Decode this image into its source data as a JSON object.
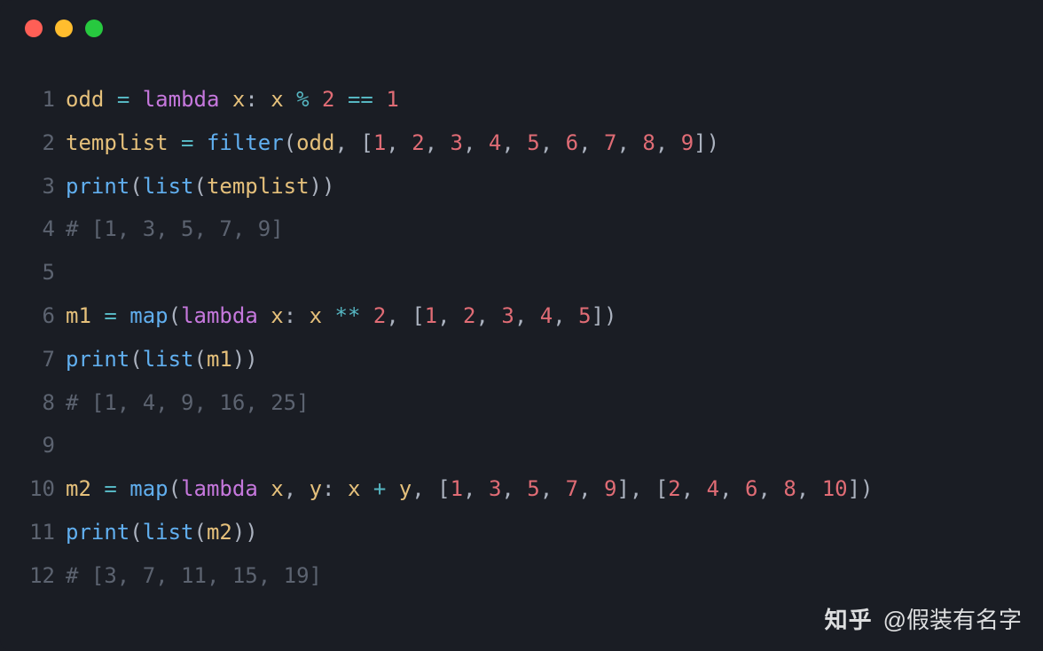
{
  "window": {
    "traffic_lights": [
      "close",
      "minimize",
      "maximize"
    ]
  },
  "watermark": {
    "logo": "知乎",
    "author": "@假装有名字"
  },
  "code": {
    "lines": [
      {
        "num": "1",
        "tokens": [
          {
            "t": "odd",
            "c": "tok-var"
          },
          {
            "t": " ",
            "c": "tok-plain"
          },
          {
            "t": "=",
            "c": "tok-op"
          },
          {
            "t": " ",
            "c": "tok-plain"
          },
          {
            "t": "lambda",
            "c": "tok-kw"
          },
          {
            "t": " ",
            "c": "tok-plain"
          },
          {
            "t": "x",
            "c": "tok-var"
          },
          {
            "t": ": ",
            "c": "tok-punct"
          },
          {
            "t": "x",
            "c": "tok-var"
          },
          {
            "t": " ",
            "c": "tok-plain"
          },
          {
            "t": "%",
            "c": "tok-op"
          },
          {
            "t": " ",
            "c": "tok-plain"
          },
          {
            "t": "2",
            "c": "tok-numred"
          },
          {
            "t": " ",
            "c": "tok-plain"
          },
          {
            "t": "==",
            "c": "tok-op"
          },
          {
            "t": " ",
            "c": "tok-plain"
          },
          {
            "t": "1",
            "c": "tok-numred"
          }
        ]
      },
      {
        "num": "2",
        "tokens": [
          {
            "t": "templist",
            "c": "tok-var"
          },
          {
            "t": " ",
            "c": "tok-plain"
          },
          {
            "t": "=",
            "c": "tok-op"
          },
          {
            "t": " ",
            "c": "tok-plain"
          },
          {
            "t": "filter",
            "c": "tok-func"
          },
          {
            "t": "(",
            "c": "tok-punct"
          },
          {
            "t": "odd",
            "c": "tok-var"
          },
          {
            "t": ", [",
            "c": "tok-punct"
          },
          {
            "t": "1",
            "c": "tok-numred"
          },
          {
            "t": ", ",
            "c": "tok-punct"
          },
          {
            "t": "2",
            "c": "tok-numred"
          },
          {
            "t": ", ",
            "c": "tok-punct"
          },
          {
            "t": "3",
            "c": "tok-numred"
          },
          {
            "t": ", ",
            "c": "tok-punct"
          },
          {
            "t": "4",
            "c": "tok-numred"
          },
          {
            "t": ", ",
            "c": "tok-punct"
          },
          {
            "t": "5",
            "c": "tok-numred"
          },
          {
            "t": ", ",
            "c": "tok-punct"
          },
          {
            "t": "6",
            "c": "tok-numred"
          },
          {
            "t": ", ",
            "c": "tok-punct"
          },
          {
            "t": "7",
            "c": "tok-numred"
          },
          {
            "t": ", ",
            "c": "tok-punct"
          },
          {
            "t": "8",
            "c": "tok-numred"
          },
          {
            "t": ", ",
            "c": "tok-punct"
          },
          {
            "t": "9",
            "c": "tok-numred"
          },
          {
            "t": "])",
            "c": "tok-punct"
          }
        ]
      },
      {
        "num": "3",
        "tokens": [
          {
            "t": "print",
            "c": "tok-func"
          },
          {
            "t": "(",
            "c": "tok-punct"
          },
          {
            "t": "list",
            "c": "tok-func"
          },
          {
            "t": "(",
            "c": "tok-punct"
          },
          {
            "t": "templist",
            "c": "tok-var"
          },
          {
            "t": "))",
            "c": "tok-punct"
          }
        ]
      },
      {
        "num": "4",
        "tokens": [
          {
            "t": "# [1, 3, 5, 7, 9]",
            "c": "tok-comment"
          }
        ]
      },
      {
        "num": "5",
        "tokens": []
      },
      {
        "num": "6",
        "tokens": [
          {
            "t": "m1",
            "c": "tok-var"
          },
          {
            "t": " ",
            "c": "tok-plain"
          },
          {
            "t": "=",
            "c": "tok-op"
          },
          {
            "t": " ",
            "c": "tok-plain"
          },
          {
            "t": "map",
            "c": "tok-func"
          },
          {
            "t": "(",
            "c": "tok-punct"
          },
          {
            "t": "lambda",
            "c": "tok-kw"
          },
          {
            "t": " ",
            "c": "tok-plain"
          },
          {
            "t": "x",
            "c": "tok-var"
          },
          {
            "t": ": ",
            "c": "tok-punct"
          },
          {
            "t": "x",
            "c": "tok-var"
          },
          {
            "t": " ",
            "c": "tok-plain"
          },
          {
            "t": "**",
            "c": "tok-op"
          },
          {
            "t": " ",
            "c": "tok-plain"
          },
          {
            "t": "2",
            "c": "tok-numred"
          },
          {
            "t": ", [",
            "c": "tok-punct"
          },
          {
            "t": "1",
            "c": "tok-numred"
          },
          {
            "t": ", ",
            "c": "tok-punct"
          },
          {
            "t": "2",
            "c": "tok-numred"
          },
          {
            "t": ", ",
            "c": "tok-punct"
          },
          {
            "t": "3",
            "c": "tok-numred"
          },
          {
            "t": ", ",
            "c": "tok-punct"
          },
          {
            "t": "4",
            "c": "tok-numred"
          },
          {
            "t": ", ",
            "c": "tok-punct"
          },
          {
            "t": "5",
            "c": "tok-numred"
          },
          {
            "t": "])",
            "c": "tok-punct"
          }
        ]
      },
      {
        "num": "7",
        "tokens": [
          {
            "t": "print",
            "c": "tok-func"
          },
          {
            "t": "(",
            "c": "tok-punct"
          },
          {
            "t": "list",
            "c": "tok-func"
          },
          {
            "t": "(",
            "c": "tok-punct"
          },
          {
            "t": "m1",
            "c": "tok-var"
          },
          {
            "t": "))",
            "c": "tok-punct"
          }
        ]
      },
      {
        "num": "8",
        "tokens": [
          {
            "t": "# [1, 4, 9, 16, 25]",
            "c": "tok-comment"
          }
        ]
      },
      {
        "num": "9",
        "tokens": []
      },
      {
        "num": "10",
        "tokens": [
          {
            "t": "m2",
            "c": "tok-var"
          },
          {
            "t": " ",
            "c": "tok-plain"
          },
          {
            "t": "=",
            "c": "tok-op"
          },
          {
            "t": " ",
            "c": "tok-plain"
          },
          {
            "t": "map",
            "c": "tok-func"
          },
          {
            "t": "(",
            "c": "tok-punct"
          },
          {
            "t": "lambda",
            "c": "tok-kw"
          },
          {
            "t": " ",
            "c": "tok-plain"
          },
          {
            "t": "x",
            "c": "tok-var"
          },
          {
            "t": ", ",
            "c": "tok-punct"
          },
          {
            "t": "y",
            "c": "tok-var"
          },
          {
            "t": ": ",
            "c": "tok-punct"
          },
          {
            "t": "x",
            "c": "tok-var"
          },
          {
            "t": " ",
            "c": "tok-plain"
          },
          {
            "t": "+",
            "c": "tok-op"
          },
          {
            "t": " ",
            "c": "tok-plain"
          },
          {
            "t": "y",
            "c": "tok-var"
          },
          {
            "t": ", [",
            "c": "tok-punct"
          },
          {
            "t": "1",
            "c": "tok-numred"
          },
          {
            "t": ", ",
            "c": "tok-punct"
          },
          {
            "t": "3",
            "c": "tok-numred"
          },
          {
            "t": ", ",
            "c": "tok-punct"
          },
          {
            "t": "5",
            "c": "tok-numred"
          },
          {
            "t": ", ",
            "c": "tok-punct"
          },
          {
            "t": "7",
            "c": "tok-numred"
          },
          {
            "t": ", ",
            "c": "tok-punct"
          },
          {
            "t": "9",
            "c": "tok-numred"
          },
          {
            "t": "], [",
            "c": "tok-punct"
          },
          {
            "t": "2",
            "c": "tok-numred"
          },
          {
            "t": ", ",
            "c": "tok-punct"
          },
          {
            "t": "4",
            "c": "tok-numred"
          },
          {
            "t": ", ",
            "c": "tok-punct"
          },
          {
            "t": "6",
            "c": "tok-numred"
          },
          {
            "t": ", ",
            "c": "tok-punct"
          },
          {
            "t": "8",
            "c": "tok-numred"
          },
          {
            "t": ", ",
            "c": "tok-punct"
          },
          {
            "t": "10",
            "c": "tok-numred"
          },
          {
            "t": "])",
            "c": "tok-punct"
          }
        ]
      },
      {
        "num": "11",
        "tokens": [
          {
            "t": "print",
            "c": "tok-func"
          },
          {
            "t": "(",
            "c": "tok-punct"
          },
          {
            "t": "list",
            "c": "tok-func"
          },
          {
            "t": "(",
            "c": "tok-punct"
          },
          {
            "t": "m2",
            "c": "tok-var"
          },
          {
            "t": "))",
            "c": "tok-punct"
          }
        ]
      },
      {
        "num": "12",
        "tokens": [
          {
            "t": "# [3, 7, 11, 15, 19]",
            "c": "tok-comment"
          }
        ]
      }
    ]
  }
}
